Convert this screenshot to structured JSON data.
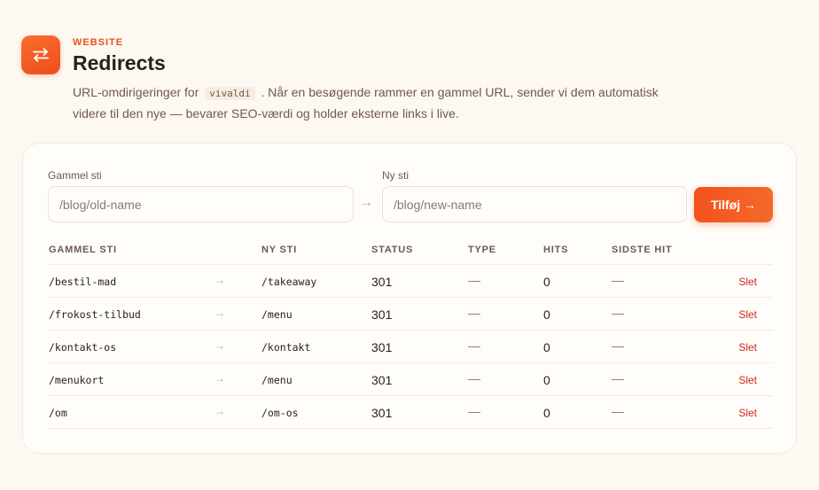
{
  "header": {
    "eyebrow": "WEBSITE",
    "title": "Redirects",
    "desc_before": "URL-omdirigeringer for",
    "site": "vivaldi",
    "desc_after": ". Når en besøgende rammer en gammel URL, sender vi dem automatisk videre til den nye — bevarer SEO-værdi og holder eksterne links i live."
  },
  "form": {
    "old_label": "Gammel sti",
    "old_placeholder": "/blog/old-name",
    "arrow": "→",
    "new_label": "Ny sti",
    "new_placeholder": "/blog/new-name",
    "submit_label": "Tilføj →"
  },
  "table": {
    "columns": [
      "GAMMEL STI",
      "NY STI",
      "STATUS",
      "TYPE",
      "HITS",
      "SIDSTE HIT"
    ],
    "rows": [
      {
        "old": "/bestil-mad",
        "arrow": "→",
        "new": "/takeaway",
        "status": "301",
        "type": "—",
        "hits": "0",
        "last_hit": "—",
        "action": "Slet"
      },
      {
        "old": "/frokost-tilbud",
        "arrow": "→",
        "new": "/menu",
        "status": "301",
        "type": "—",
        "hits": "0",
        "last_hit": "—",
        "action": "Slet"
      },
      {
        "old": "/kontakt-os",
        "arrow": "→",
        "new": "/kontakt",
        "status": "301",
        "type": "—",
        "hits": "0",
        "last_hit": "—",
        "action": "Slet"
      },
      {
        "old": "/menukort",
        "arrow": "→",
        "new": "/menu",
        "status": "301",
        "type": "—",
        "hits": "0",
        "last_hit": "—",
        "action": "Slet"
      },
      {
        "old": "/om",
        "arrow": "→",
        "new": "/om-os",
        "status": "301",
        "type": "—",
        "hits": "0",
        "last_hit": "—",
        "action": "Slet"
      }
    ]
  },
  "icons": {
    "logo": "swap-arrows-icon"
  },
  "colors": {
    "accent": "#f0541e",
    "background": "#fdf8f1",
    "delete": "#c8281e"
  }
}
